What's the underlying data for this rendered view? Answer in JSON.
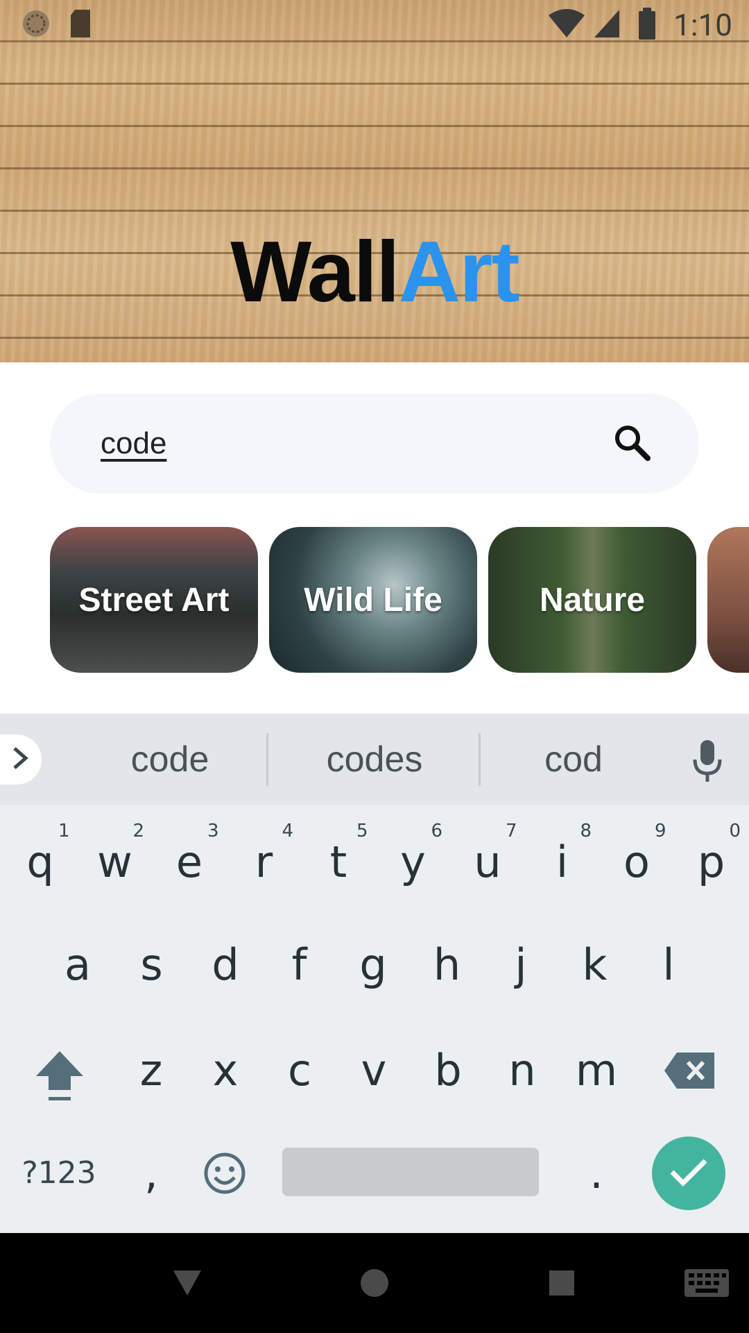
{
  "status_bar": {
    "time": "1:10",
    "icons": [
      "sync-icon",
      "sd-card-icon",
      "wifi-icon",
      "signal-icon",
      "battery-icon"
    ]
  },
  "header": {
    "title_part1": "Wall",
    "title_part2": "Art",
    "title_part1_color": "#0b0b0b",
    "title_part2_color": "#2b93ee"
  },
  "search": {
    "value": "code",
    "icon": "search-icon"
  },
  "categories": [
    {
      "label": "Street Art"
    },
    {
      "label": "Wild Life"
    },
    {
      "label": "Nature"
    },
    {
      "label": ""
    }
  ],
  "keyboard": {
    "suggestions": [
      "code",
      "codes",
      "cod"
    ],
    "row1": [
      {
        "key": "q",
        "hint": "1"
      },
      {
        "key": "w",
        "hint": "2"
      },
      {
        "key": "e",
        "hint": "3"
      },
      {
        "key": "r",
        "hint": "4"
      },
      {
        "key": "t",
        "hint": "5"
      },
      {
        "key": "y",
        "hint": "6"
      },
      {
        "key": "u",
        "hint": "7"
      },
      {
        "key": "i",
        "hint": "8"
      },
      {
        "key": "o",
        "hint": "9"
      },
      {
        "key": "p",
        "hint": "0"
      }
    ],
    "row2": [
      "a",
      "s",
      "d",
      "f",
      "g",
      "h",
      "j",
      "k",
      "l"
    ],
    "row3": [
      "z",
      "x",
      "c",
      "v",
      "b",
      "n",
      "m"
    ],
    "symbols_label": "?123",
    "comma": ",",
    "period": ".",
    "accent_color": "#43b59f"
  },
  "nav_bar": {
    "buttons": [
      "back-icon",
      "home-icon",
      "recents-icon",
      "keyboard-switch-icon"
    ]
  }
}
